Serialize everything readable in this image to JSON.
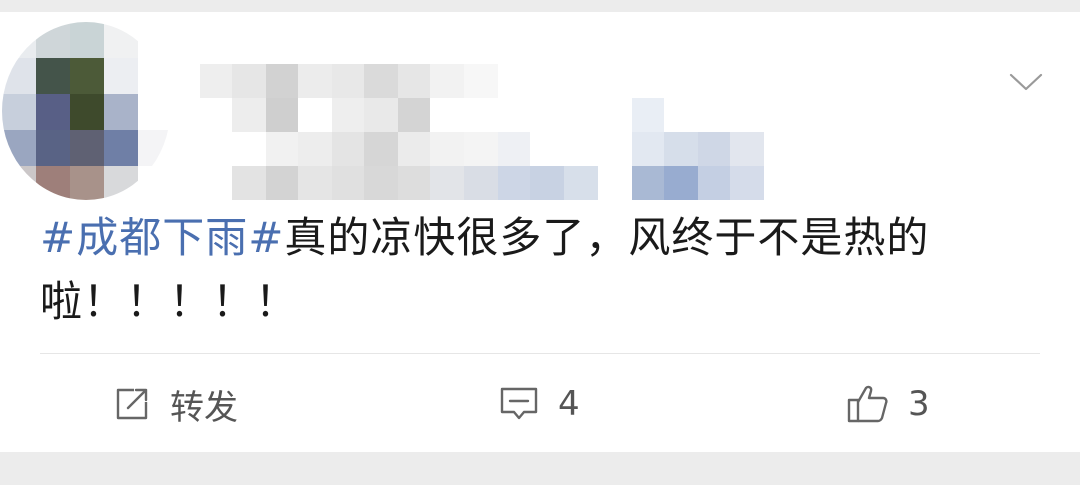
{
  "post": {
    "hashtag": "#成都下雨#",
    "text_line1": "真的凉快很多了，风终于不是热的",
    "text_line2": "啦！！！！！"
  },
  "actions": {
    "repost_label": "转发",
    "comment_count": "4",
    "like_count": "3"
  },
  "icons": {
    "menu": "chevron-down-icon",
    "repost": "share-icon",
    "comment": "comment-icon",
    "like": "thumbs-up-icon"
  },
  "colors": {
    "hashtag": "#4a6fb0",
    "text": "#1a1a1a",
    "action": "#555555",
    "background": "#ececec",
    "card": "#ffffff"
  }
}
